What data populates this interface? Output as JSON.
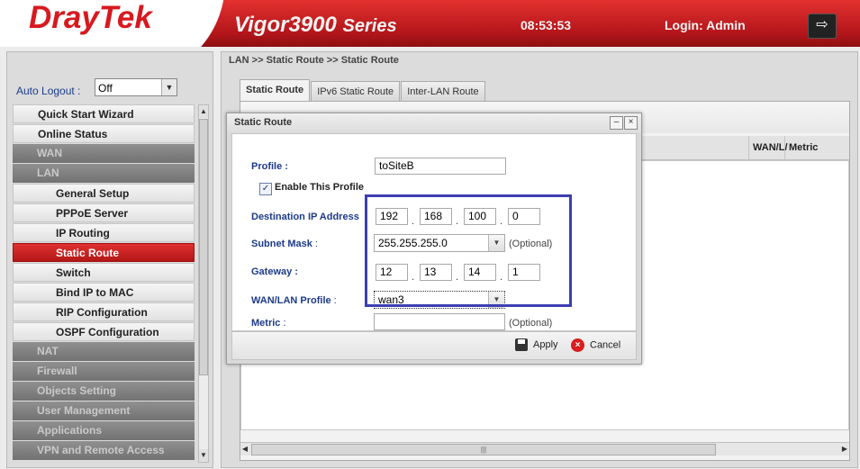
{
  "header": {
    "logo": "DrayTek",
    "product_model": "Vigor3900",
    "product_series": "Series",
    "clock": "08:53:53",
    "login": "Login: Admin",
    "logout_icon": "logout-icon",
    "brand_color": "#c8191e"
  },
  "sidebar": {
    "auto_logout_label": "Auto Logout :",
    "auto_logout_value": "Off",
    "items": [
      {
        "label": "Quick Start Wizard",
        "kind": "top"
      },
      {
        "label": "Online Status",
        "kind": "top"
      },
      {
        "label": "WAN",
        "kind": "category"
      },
      {
        "label": "LAN",
        "kind": "category"
      },
      {
        "label": "General Setup",
        "kind": "sub"
      },
      {
        "label": "PPPoE Server",
        "kind": "sub"
      },
      {
        "label": "IP Routing",
        "kind": "sub"
      },
      {
        "label": "Static Route",
        "kind": "sub",
        "active": true
      },
      {
        "label": "Switch",
        "kind": "sub"
      },
      {
        "label": "Bind IP to MAC",
        "kind": "sub"
      },
      {
        "label": "RIP Configuration",
        "kind": "sub"
      },
      {
        "label": "OSPF Configuration",
        "kind": "sub"
      },
      {
        "label": "NAT",
        "kind": "category"
      },
      {
        "label": "Firewall",
        "kind": "category"
      },
      {
        "label": "Objects Setting",
        "kind": "category"
      },
      {
        "label": "User Management",
        "kind": "category"
      },
      {
        "label": "Applications",
        "kind": "category"
      },
      {
        "label": "VPN and Remote Access",
        "kind": "category"
      }
    ]
  },
  "main": {
    "breadcrumb": "LAN >> Static Route >> Static Route",
    "tabs": [
      {
        "label": "Static Route",
        "active": true
      },
      {
        "label": "IPv6 Static Route"
      },
      {
        "label": "Inter-LAN Route"
      }
    ],
    "grid_columns": [
      "WAN/L/",
      "Metric"
    ]
  },
  "dialog": {
    "title": "Static Route",
    "min_icon": "minimize-icon",
    "close_icon": "close-icon",
    "profile_label": "Profile :",
    "profile_value": "toSiteB",
    "enable_label": "Enable This Profile",
    "enable_checked": true,
    "dest_label": "Destination IP Address",
    "dest_ip": [
      "192",
      "168",
      "100",
      "0"
    ],
    "subnet_label": "Subnet Mask",
    "subnet_suffix": " :",
    "subnet_value": "255.255.255.0",
    "optional": "(Optional)",
    "gateway_label": "Gateway :",
    "gateway_ip": [
      "12",
      "13",
      "14",
      "1"
    ],
    "wanlan_label": "WAN/LAN Profile",
    "wanlan_suffix": " :",
    "wanlan_value": "wan3",
    "metric_label": "Metric",
    "metric_suffix": " :",
    "metric_value": "",
    "metric_optional": "(Optional)",
    "apply_label": "Apply",
    "cancel_label": "Cancel",
    "highlight_color": "#3c3fb0"
  }
}
